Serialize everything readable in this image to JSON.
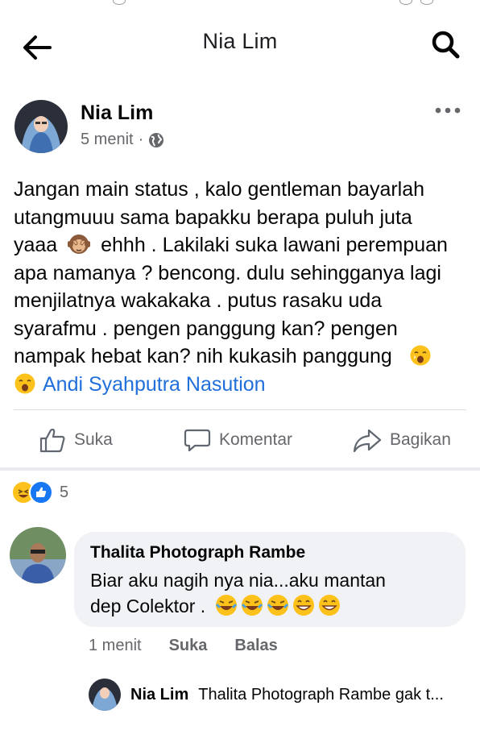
{
  "header": {
    "title": "Nia Lim",
    "back_icon": "arrow-left-icon",
    "search_icon": "search-icon"
  },
  "post": {
    "author": "Nia Lim",
    "time": "5 menit",
    "separator": "·",
    "audience_icon": "globe-icon",
    "lines": [
      "Jangan main status , kalo gentleman bayarlah",
      "utangmuuu sama bapakku berapa puluh juta",
      "yaaa",
      "ehhh . Lakilaki suka lawani perempuan",
      "apa namanya ? bencong. dulu sehingganya lagi",
      "menjilatnya wakakaka .  putus rasaku uda",
      "syarafmu . pengen panggung kan? pengen",
      "nampak hebat kan? nih kukasih panggung"
    ],
    "mention": "Andi Syahputra Nasution",
    "emoji": {
      "monkey": "see-no-evil-monkey",
      "yawn": "yawning-face"
    }
  },
  "actions": {
    "like": "Suka",
    "comment": "Komentar",
    "share": "Bagikan"
  },
  "reactions": {
    "count": "5",
    "types": [
      "haha",
      "like"
    ]
  },
  "comment": {
    "author": "Thalita Photograph Rambe",
    "line1": "Biar aku nagih nya nia...aku mantan",
    "line2": "dep Colektor .",
    "emoji": [
      "face-with-tears-of-joy",
      "face-with-tears-of-joy",
      "face-with-tears-of-joy",
      "grinning-face",
      "grinning-face"
    ],
    "time": "1 menit",
    "like": "Suka",
    "reply": "Balas"
  },
  "reply": {
    "author": "Nia Lim",
    "text": "Thalita Photograph Rambe gak t..."
  },
  "colors": {
    "link": "#216fdb",
    "meta": "#65676b",
    "bubble": "#f0f2f5",
    "like_blue": "#1877f2"
  }
}
